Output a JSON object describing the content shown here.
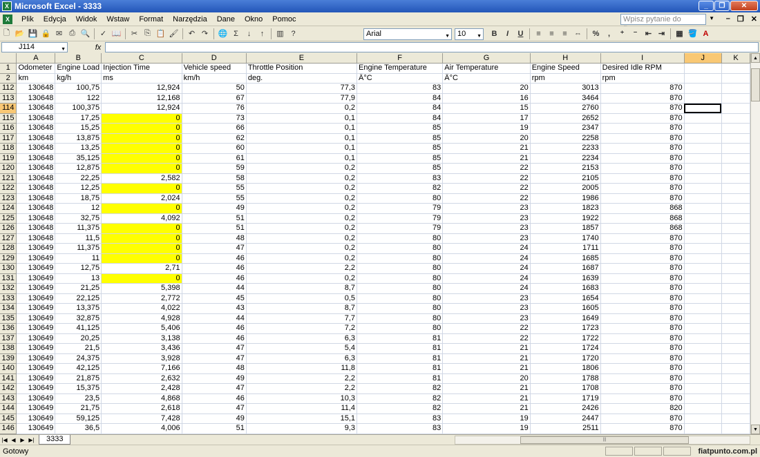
{
  "window": {
    "title": "Microsoft Excel - 3333",
    "app_icon": "X"
  },
  "menu": {
    "items": [
      "Plik",
      "Edycja",
      "Widok",
      "Wstaw",
      "Format",
      "Narzędzia",
      "Dane",
      "Okno",
      "Pomoc"
    ],
    "help_placeholder": "Wpisz pytanie do Pomocy"
  },
  "toolbar": {
    "font": "Arial",
    "font_size": "10"
  },
  "formula": {
    "name_box": "J114",
    "fx": "fx",
    "value": ""
  },
  "grid": {
    "columns": [
      {
        "letter": "A",
        "width": 56
      },
      {
        "letter": "B",
        "width": 54
      },
      {
        "letter": "C",
        "width": 118
      },
      {
        "letter": "D",
        "width": 94
      },
      {
        "letter": "E",
        "width": 163
      },
      {
        "letter": "F",
        "width": 125
      },
      {
        "letter": "G",
        "width": 128
      },
      {
        "letter": "H",
        "width": 103
      },
      {
        "letter": "I",
        "width": 122
      },
      {
        "letter": "J",
        "width": 56
      },
      {
        "letter": "K",
        "width": 42
      }
    ],
    "active_col": "J",
    "active_row": "114",
    "header_rows": [
      {
        "row": "1",
        "cells": [
          "Odometer",
          "Engine Load",
          "Injection Time",
          "Vehicle speed",
          "Throttle Position",
          "Engine Temperature",
          "Air Temperature",
          "Engine Speed",
          "Desired Idle RPM",
          "",
          ""
        ]
      },
      {
        "row": "2",
        "cells": [
          "km",
          "kg/h",
          "ms",
          "km/h",
          "deg.",
          "Â°C",
          "Â°C",
          "rpm",
          "rpm",
          "",
          ""
        ]
      }
    ],
    "rows": [
      {
        "row": "112",
        "hl": false,
        "cells": [
          "130648",
          "100,75",
          "12,924",
          "50",
          "77,3",
          "83",
          "20",
          "3013",
          "870"
        ]
      },
      {
        "row": "113",
        "hl": false,
        "cells": [
          "130648",
          "122",
          "12,168",
          "67",
          "77,9",
          "84",
          "16",
          "3464",
          "870"
        ]
      },
      {
        "row": "114",
        "hl": false,
        "cells": [
          "130648",
          "100,375",
          "12,924",
          "76",
          "0,2",
          "84",
          "15",
          "2760",
          "870"
        ]
      },
      {
        "row": "115",
        "hl": true,
        "cells": [
          "130648",
          "17,25",
          "0",
          "73",
          "0,1",
          "84",
          "17",
          "2652",
          "870"
        ]
      },
      {
        "row": "116",
        "hl": true,
        "cells": [
          "130648",
          "15,25",
          "0",
          "66",
          "0,1",
          "85",
          "19",
          "2347",
          "870"
        ]
      },
      {
        "row": "117",
        "hl": true,
        "cells": [
          "130648",
          "13,875",
          "0",
          "62",
          "0,1",
          "85",
          "20",
          "2258",
          "870"
        ]
      },
      {
        "row": "118",
        "hl": true,
        "cells": [
          "130648",
          "13,25",
          "0",
          "60",
          "0,1",
          "85",
          "21",
          "2233",
          "870"
        ]
      },
      {
        "row": "119",
        "hl": true,
        "cells": [
          "130648",
          "35,125",
          "0",
          "61",
          "0,1",
          "85",
          "21",
          "2234",
          "870"
        ]
      },
      {
        "row": "120",
        "hl": true,
        "cells": [
          "130648",
          "12,875",
          "0",
          "59",
          "0,2",
          "85",
          "22",
          "2153",
          "870"
        ]
      },
      {
        "row": "121",
        "hl": false,
        "cells": [
          "130648",
          "22,25",
          "2,582",
          "58",
          "0,2",
          "83",
          "22",
          "2105",
          "870"
        ]
      },
      {
        "row": "122",
        "hl": true,
        "cells": [
          "130648",
          "12,25",
          "0",
          "55",
          "0,2",
          "82",
          "22",
          "2005",
          "870"
        ]
      },
      {
        "row": "123",
        "hl": false,
        "cells": [
          "130648",
          "18,75",
          "2,024",
          "55",
          "0,2",
          "80",
          "22",
          "1986",
          "870"
        ]
      },
      {
        "row": "124",
        "hl": true,
        "cells": [
          "130648",
          "12",
          "0",
          "49",
          "0,2",
          "79",
          "23",
          "1823",
          "868"
        ]
      },
      {
        "row": "125",
        "hl": false,
        "cells": [
          "130648",
          "32,75",
          "4,092",
          "51",
          "0,2",
          "79",
          "23",
          "1922",
          "868"
        ]
      },
      {
        "row": "126",
        "hl": true,
        "cells": [
          "130648",
          "11,375",
          "0",
          "51",
          "0,2",
          "79",
          "23",
          "1857",
          "868"
        ]
      },
      {
        "row": "127",
        "hl": true,
        "cells": [
          "130648",
          "11,5",
          "0",
          "48",
          "0,2",
          "80",
          "23",
          "1740",
          "870"
        ]
      },
      {
        "row": "128",
        "hl": true,
        "cells": [
          "130649",
          "11,375",
          "0",
          "47",
          "0,2",
          "80",
          "24",
          "1711",
          "870"
        ]
      },
      {
        "row": "129",
        "hl": true,
        "cells": [
          "130649",
          "11",
          "0",
          "46",
          "0,2",
          "80",
          "24",
          "1685",
          "870"
        ]
      },
      {
        "row": "130",
        "hl": false,
        "cells": [
          "130649",
          "12,75",
          "2,71",
          "46",
          "2,2",
          "80",
          "24",
          "1687",
          "870"
        ]
      },
      {
        "row": "131",
        "hl": true,
        "cells": [
          "130649",
          "13",
          "0",
          "46",
          "0,2",
          "80",
          "24",
          "1639",
          "870"
        ]
      },
      {
        "row": "132",
        "hl": false,
        "cells": [
          "130649",
          "21,25",
          "5,398",
          "44",
          "8,7",
          "80",
          "24",
          "1683",
          "870"
        ]
      },
      {
        "row": "133",
        "hl": false,
        "cells": [
          "130649",
          "22,125",
          "2,772",
          "45",
          "0,5",
          "80",
          "23",
          "1654",
          "870"
        ]
      },
      {
        "row": "134",
        "hl": false,
        "cells": [
          "130649",
          "13,375",
          "4,022",
          "43",
          "8,7",
          "80",
          "23",
          "1605",
          "870"
        ]
      },
      {
        "row": "135",
        "hl": false,
        "cells": [
          "130649",
          "32,875",
          "4,928",
          "44",
          "7,7",
          "80",
          "23",
          "1649",
          "870"
        ]
      },
      {
        "row": "136",
        "hl": false,
        "cells": [
          "130649",
          "41,125",
          "5,406",
          "46",
          "7,2",
          "80",
          "22",
          "1723",
          "870"
        ]
      },
      {
        "row": "137",
        "hl": false,
        "cells": [
          "130649",
          "20,25",
          "3,138",
          "46",
          "6,3",
          "81",
          "22",
          "1722",
          "870"
        ]
      },
      {
        "row": "138",
        "hl": false,
        "cells": [
          "130649",
          "21,5",
          "3,436",
          "47",
          "5,4",
          "81",
          "21",
          "1724",
          "870"
        ]
      },
      {
        "row": "139",
        "hl": false,
        "cells": [
          "130649",
          "24,375",
          "3,928",
          "47",
          "6,3",
          "81",
          "21",
          "1720",
          "870"
        ]
      },
      {
        "row": "140",
        "hl": false,
        "cells": [
          "130649",
          "42,125",
          "7,166",
          "48",
          "11,8",
          "81",
          "21",
          "1806",
          "870"
        ]
      },
      {
        "row": "141",
        "hl": false,
        "cells": [
          "130649",
          "21,875",
          "2,632",
          "49",
          "2,2",
          "81",
          "20",
          "1788",
          "870"
        ]
      },
      {
        "row": "142",
        "hl": false,
        "cells": [
          "130649",
          "15,375",
          "2,428",
          "47",
          "2,2",
          "82",
          "21",
          "1708",
          "870"
        ]
      },
      {
        "row": "143",
        "hl": false,
        "cells": [
          "130649",
          "23,5",
          "4,868",
          "46",
          "10,3",
          "82",
          "21",
          "1719",
          "870"
        ]
      },
      {
        "row": "144",
        "hl": false,
        "cells": [
          "130649",
          "21,75",
          "2,618",
          "47",
          "11,4",
          "82",
          "21",
          "2426",
          "820"
        ]
      },
      {
        "row": "145",
        "hl": false,
        "cells": [
          "130649",
          "59,125",
          "7,428",
          "49",
          "15,1",
          "83",
          "19",
          "2447",
          "870"
        ]
      },
      {
        "row": "146",
        "hl": false,
        "cells": [
          "130649",
          "36,5",
          "4,006",
          "51",
          "9,3",
          "83",
          "19",
          "2511",
          "870"
        ]
      }
    ]
  },
  "sheet_tabs": {
    "active": "3333"
  },
  "status": {
    "text": "Gotowy",
    "watermark": "fiatpunto.com.pl"
  }
}
